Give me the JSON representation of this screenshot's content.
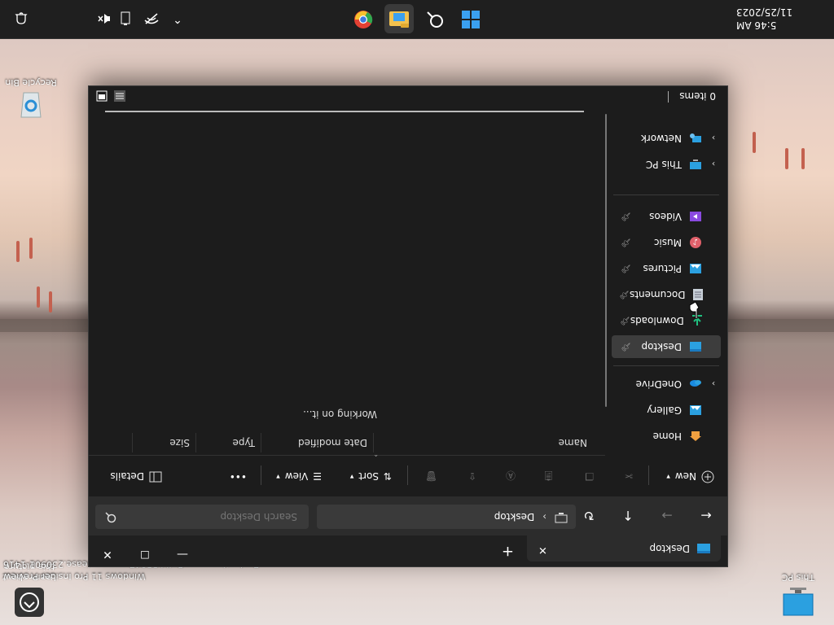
{
  "desktop": {
    "this_pc_label": "This PC",
    "learn_label": "Learn about this picture",
    "recycle_label": "Recycle Bin",
    "eval_line1": "Windows 11 Pro Insider Preview",
    "eval_line2": "Evaluation copy. Build 25947.rs_prerelease.230901-1416"
  },
  "taskbar": {
    "icons": [
      "windows-start-icon",
      "search-icon",
      "file-explorer-icon",
      "chrome-icon"
    ],
    "tray_icons": [
      "chevron-up-icon",
      "network-off-icon",
      "battery-icon",
      "volume-mute-icon",
      "notification-bell-icon"
    ],
    "time": "5:46 AM",
    "date": "11/25/2023"
  },
  "window": {
    "tab_title": "Desktop",
    "tab_close": "✕",
    "new_tab": "+",
    "controls": {
      "minimize": "—",
      "maximize": "☐",
      "close": "✕"
    },
    "address": {
      "segments": [
        "Desktop"
      ],
      "chevron": "›"
    },
    "search": {
      "placeholder": "Search Desktop"
    },
    "commands": {
      "new": "New",
      "sort": "Sort",
      "view": "View",
      "more": "•••",
      "details": "Details"
    },
    "sidebar": {
      "top": [
        {
          "label": "Home",
          "icon": "home-icon"
        },
        {
          "label": "Gallery",
          "icon": "gallery-icon"
        },
        {
          "label": "OneDrive",
          "icon": "onedrive-icon",
          "chev": "›"
        }
      ],
      "pinned": [
        {
          "label": "Desktop",
          "icon": "desktop-folder-icon",
          "selected": true
        },
        {
          "label": "Downloads",
          "icon": "downloads-icon"
        },
        {
          "label": "Documents",
          "icon": "documents-icon"
        },
        {
          "label": "Pictures",
          "icon": "pictures-icon"
        },
        {
          "label": "Music",
          "icon": "music-icon"
        },
        {
          "label": "Videos",
          "icon": "videos-icon"
        }
      ],
      "bottom": [
        {
          "label": "This PC",
          "icon": "this-pc-icon",
          "chev": "›"
        },
        {
          "label": "Network",
          "icon": "network-icon",
          "chev": "›"
        }
      ]
    },
    "columns": [
      "Name",
      "Date modified",
      "Type",
      "Size"
    ],
    "working_text": "Working on it...",
    "status_items": "0 items"
  },
  "colors": {
    "window_bg": "#1c1c1c",
    "accent": "#0078d4",
    "selected": "#3d3d3d"
  }
}
